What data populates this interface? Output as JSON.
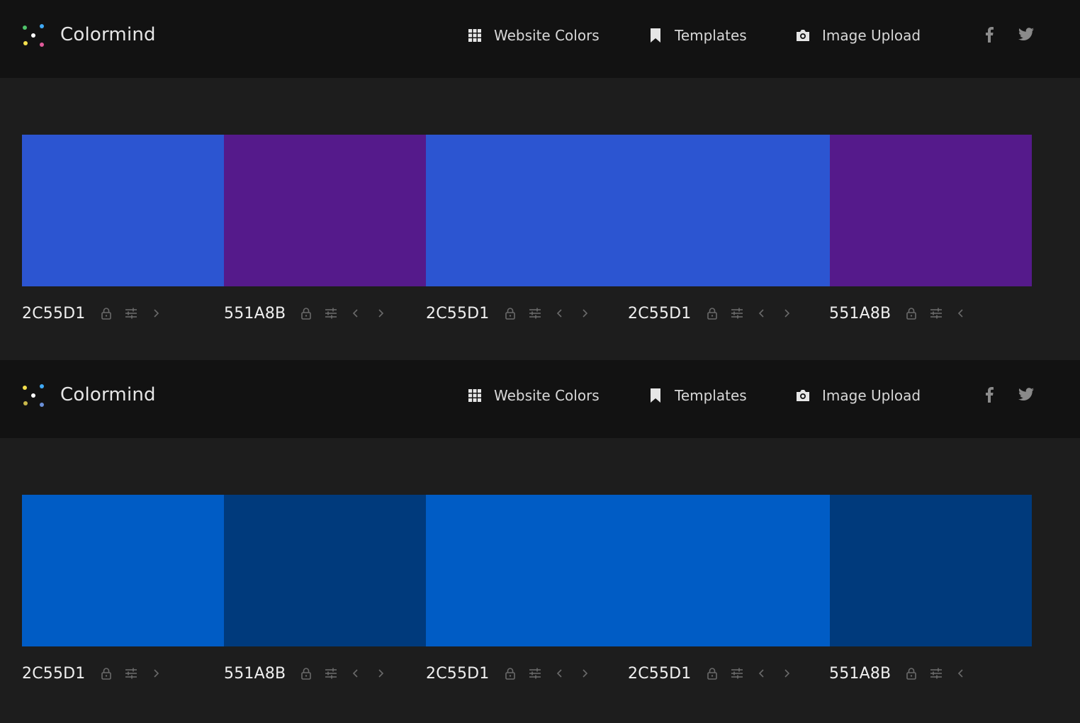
{
  "brand": {
    "name": "Colormind",
    "logo_dots": [
      "#3fa9f5",
      "#e05a5a",
      "#9a64d8",
      "#f4e04d",
      "#4fc36b",
      "#ffffff"
    ]
  },
  "nav": {
    "website_colors": "Website Colors",
    "templates": "Templates",
    "image_upload": "Image Upload"
  },
  "sections": [
    {
      "swatches": [
        {
          "hex_label": "2C55D1",
          "color": "#2c55d1"
        },
        {
          "hex_label": "551A8B",
          "color": "#551a8b"
        },
        {
          "hex_label": "2C55D1",
          "color": "#2c55d1"
        },
        {
          "hex_label": "2C55D1",
          "color": "#2c55d1"
        },
        {
          "hex_label": "551A8B",
          "color": "#551a8b"
        }
      ]
    },
    {
      "swatches": [
        {
          "hex_label": "2C55D1",
          "color": "#005cc5"
        },
        {
          "hex_label": "551A8B",
          "color": "#003a7c"
        },
        {
          "hex_label": "2C55D1",
          "color": "#005cc5"
        },
        {
          "hex_label": "2C55D1",
          "color": "#005cc5"
        },
        {
          "hex_label": "551A8B",
          "color": "#003a7c"
        }
      ]
    }
  ],
  "icons": {
    "lock": "lock-icon",
    "adjust": "sliders-icon",
    "left": "chevron-left-icon",
    "right": "chevron-right-icon",
    "grid": "grid-icon",
    "bookmark": "bookmark-icon",
    "camera": "camera-icon",
    "facebook": "facebook-icon",
    "twitter": "twitter-icon"
  }
}
